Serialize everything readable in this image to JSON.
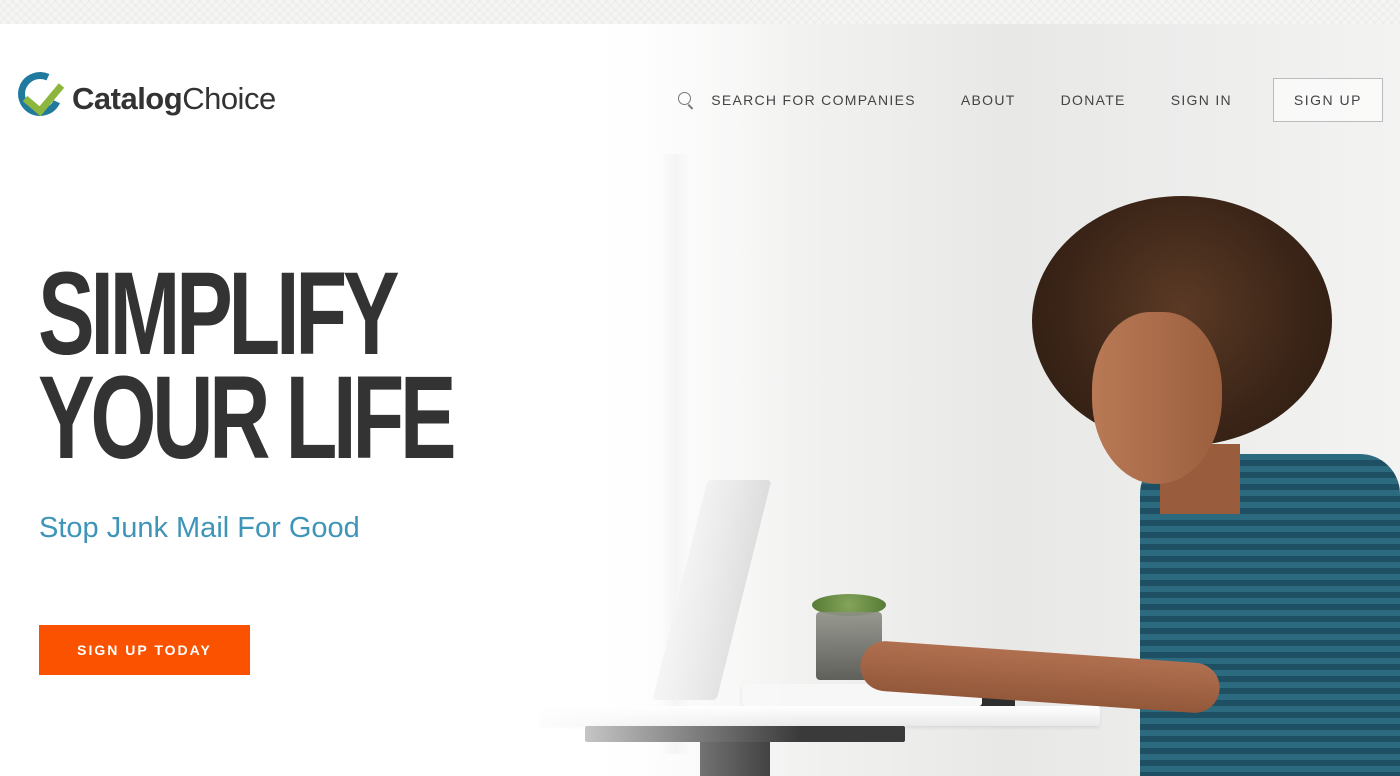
{
  "brand": {
    "logo_bold": "Catalog",
    "logo_light": "Choice",
    "colors": {
      "ring": "#1f7a9e",
      "check": "#8cb63c"
    }
  },
  "nav": {
    "search_label": "SEARCH FOR COMPANIES",
    "search_icon": "search-icon",
    "about_label": "ABOUT",
    "donate_label": "DONATE",
    "signin_label": "SIGN IN",
    "signup_label": "SIGN UP"
  },
  "hero": {
    "headline_line1": "SIMPLIFY",
    "headline_line2": "YOUR LIFE",
    "subheadline": "Stop Junk Mail For Good",
    "cta_label": "SIGN UP TODAY",
    "colors": {
      "headline": "#333333",
      "subheadline": "#3e95b8",
      "cta": "#fb5200"
    }
  }
}
